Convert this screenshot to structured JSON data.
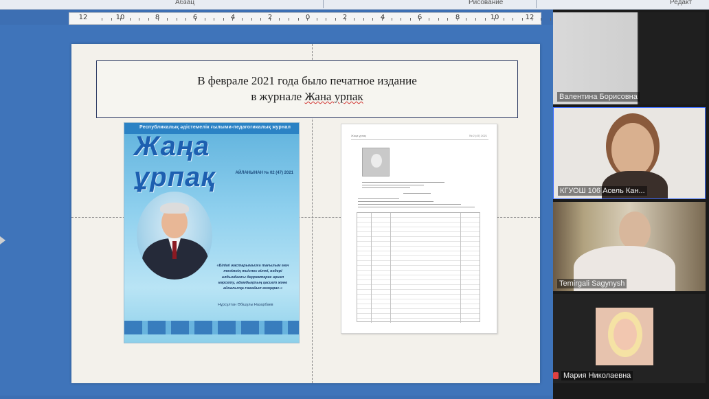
{
  "window": {
    "ribbon_left_label": "Абзац",
    "ribbon_mid_label": "Рисование",
    "ribbon_right_label": "Редакт"
  },
  "ruler": {
    "labels": [
      "12",
      "10",
      "8",
      "6",
      "4",
      "2",
      "0",
      "2",
      "4",
      "6",
      "8",
      "10",
      "12"
    ]
  },
  "slide": {
    "title_line1": "В феврале 2021 года было печатное издание",
    "title_line2_prefix": "в журнале ",
    "title_line2_name": "Жана урпак"
  },
  "cover": {
    "subtitle": "Республикалық әдістемелік ғылыми-педагогикалық журнал",
    "title": "Жаңа ұрпақ",
    "issue": "АЙЛАНЫНАН № 02 (47) 2021",
    "quote": "«Білімі жастарымызға тағылым мен тәлімнің тиіспес кілті, өздері алдынданғы дерректерге арнап көрсету, адамдықтың қасиет және айналысқа ғажайып көзқарас.»",
    "author": "Нұрсұлтан Әбішұлы Назарбаев"
  },
  "article": {
    "header_left": "Жаңа ұрпақ",
    "header_right": "№ 2 (47) 2021"
  },
  "participants": [
    {
      "name": "Валентина Борисовна"
    },
    {
      "name": "КГУОШ 106 Асель Кан..."
    },
    {
      "name": "Temirgali Sagynysh"
    },
    {
      "name": "Мария Николаевна"
    }
  ],
  "colors": {
    "desktop": "#3d6fb3",
    "slide_bg": "#f3f1eb",
    "cover_title": "#1d5fb0",
    "active_speaker_border": "#3b6cff"
  }
}
